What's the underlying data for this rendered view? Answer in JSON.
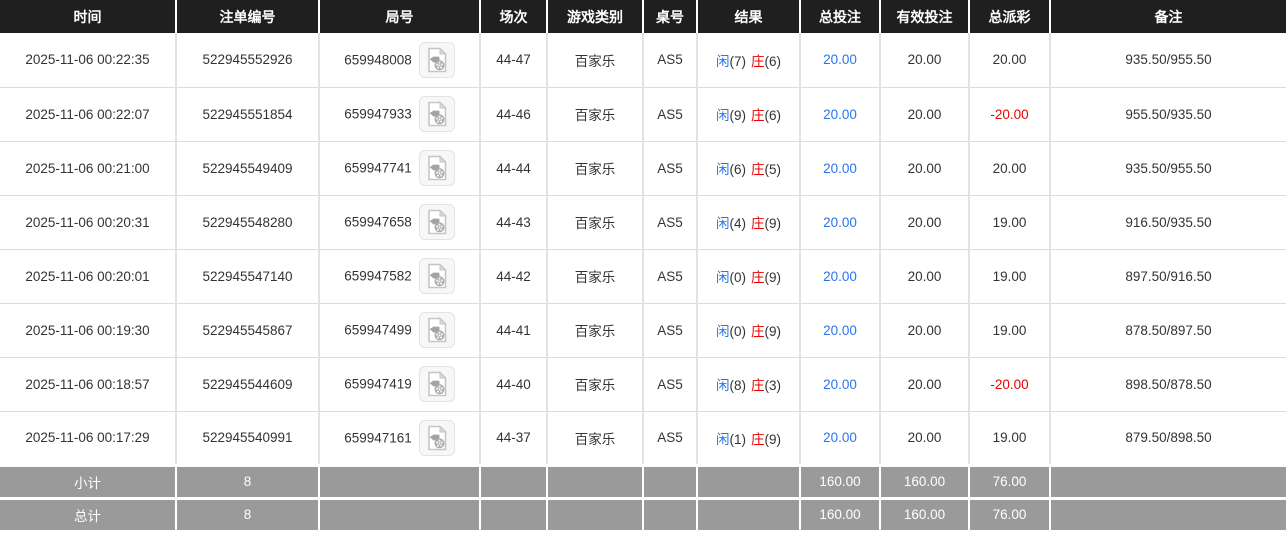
{
  "header": {
    "columns": [
      {
        "key": "time",
        "label": "时间"
      },
      {
        "key": "bet_id",
        "label": "注单编号"
      },
      {
        "key": "round_id",
        "label": "局号"
      },
      {
        "key": "session",
        "label": "场次"
      },
      {
        "key": "game_type",
        "label": "游戏类别"
      },
      {
        "key": "table_no",
        "label": "桌号"
      },
      {
        "key": "result",
        "label": "结果"
      },
      {
        "key": "total_bet",
        "label": "总投注"
      },
      {
        "key": "valid_bet",
        "label": "有效投注"
      },
      {
        "key": "payout",
        "label": "总派彩"
      },
      {
        "key": "remark",
        "label": "备注"
      }
    ]
  },
  "rows": [
    {
      "time": "2025-11-06 00:22:35",
      "bet_id": "522945552926",
      "round_id": "659948008",
      "session": "44-47",
      "game_type": "百家乐",
      "table_no": "AS5",
      "result": {
        "player_label": "闲",
        "player_score": "(7)",
        "banker_label": "庄",
        "banker_score": "(6)"
      },
      "total_bet": "20.00",
      "valid_bet": "20.00",
      "payout": "20.00",
      "payout_negative": false,
      "remark": "935.50/955.50"
    },
    {
      "time": "2025-11-06 00:22:07",
      "bet_id": "522945551854",
      "round_id": "659947933",
      "session": "44-46",
      "game_type": "百家乐",
      "table_no": "AS5",
      "result": {
        "player_label": "闲",
        "player_score": "(9)",
        "banker_label": "庄",
        "banker_score": "(6)"
      },
      "total_bet": "20.00",
      "valid_bet": "20.00",
      "payout": "-20.00",
      "payout_negative": true,
      "remark": "955.50/935.50"
    },
    {
      "time": "2025-11-06 00:21:00",
      "bet_id": "522945549409",
      "round_id": "659947741",
      "session": "44-44",
      "game_type": "百家乐",
      "table_no": "AS5",
      "result": {
        "player_label": "闲",
        "player_score": "(6)",
        "banker_label": "庄",
        "banker_score": "(5)"
      },
      "total_bet": "20.00",
      "valid_bet": "20.00",
      "payout": "20.00",
      "payout_negative": false,
      "remark": "935.50/955.50"
    },
    {
      "time": "2025-11-06 00:20:31",
      "bet_id": "522945548280",
      "round_id": "659947658",
      "session": "44-43",
      "game_type": "百家乐",
      "table_no": "AS5",
      "result": {
        "player_label": "闲",
        "player_score": "(4)",
        "banker_label": "庄",
        "banker_score": "(9)"
      },
      "total_bet": "20.00",
      "valid_bet": "20.00",
      "payout": "19.00",
      "payout_negative": false,
      "remark": "916.50/935.50"
    },
    {
      "time": "2025-11-06 00:20:01",
      "bet_id": "522945547140",
      "round_id": "659947582",
      "session": "44-42",
      "game_type": "百家乐",
      "table_no": "AS5",
      "result": {
        "player_label": "闲",
        "player_score": "(0)",
        "banker_label": "庄",
        "banker_score": "(9)"
      },
      "total_bet": "20.00",
      "valid_bet": "20.00",
      "payout": "19.00",
      "payout_negative": false,
      "remark": "897.50/916.50"
    },
    {
      "time": "2025-11-06 00:19:30",
      "bet_id": "522945545867",
      "round_id": "659947499",
      "session": "44-41",
      "game_type": "百家乐",
      "table_no": "AS5",
      "result": {
        "player_label": "闲",
        "player_score": "(0)",
        "banker_label": "庄",
        "banker_score": "(9)"
      },
      "total_bet": "20.00",
      "valid_bet": "20.00",
      "payout": "19.00",
      "payout_negative": false,
      "remark": "878.50/897.50"
    },
    {
      "time": "2025-11-06 00:18:57",
      "bet_id": "522945544609",
      "round_id": "659947419",
      "session": "44-40",
      "game_type": "百家乐",
      "table_no": "AS5",
      "result": {
        "player_label": "闲",
        "player_score": "(8)",
        "banker_label": "庄",
        "banker_score": "(3)"
      },
      "total_bet": "20.00",
      "valid_bet": "20.00",
      "payout": "-20.00",
      "payout_negative": true,
      "remark": "898.50/878.50"
    },
    {
      "time": "2025-11-06 00:17:29",
      "bet_id": "522945540991",
      "round_id": "659947161",
      "session": "44-37",
      "game_type": "百家乐",
      "table_no": "AS5",
      "result": {
        "player_label": "闲",
        "player_score": "(1)",
        "banker_label": "庄",
        "banker_score": "(9)"
      },
      "total_bet": "20.00",
      "valid_bet": "20.00",
      "payout": "19.00",
      "payout_negative": false,
      "remark": "879.50/898.50"
    }
  ],
  "footer": {
    "subtotal": {
      "label": "小计",
      "count": "8",
      "total_bet": "160.00",
      "valid_bet": "160.00",
      "payout": "76.00"
    },
    "total": {
      "label": "总计",
      "count": "8",
      "total_bet": "160.00",
      "valid_bet": "160.00",
      "payout": "76.00"
    }
  },
  "icons": {
    "video_replay": "video-file-icon"
  },
  "colors": {
    "accent_blue": "#2676ee",
    "accent_red": "#ea0000",
    "header_bg": "#1f1f1f",
    "footer_bg": "#9a9a9a"
  }
}
